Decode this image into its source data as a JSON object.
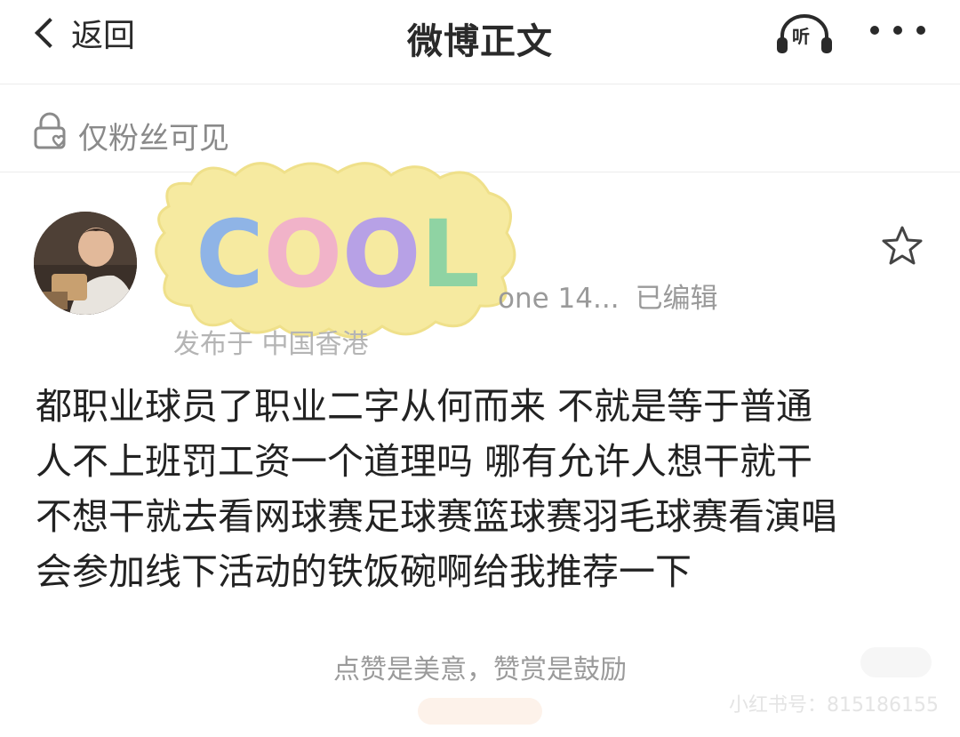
{
  "nav": {
    "back_label": "返回",
    "title": "微博正文",
    "listen_label": "听"
  },
  "visibility": {
    "label": "仅粉丝可见"
  },
  "post": {
    "sticker_text": "COOL",
    "device_text": "one 14...",
    "edited_label": "已编辑",
    "location": "发布于 中国香港",
    "body_lines": [
      "都职业球员了职业二字从何而来 不就是等于普通",
      "人不上班罚工资一个道理吗 哪有允许人想干就干",
      "不想干就去看网球赛足球赛篮球赛羽毛球赛看演唱",
      "会参加线下活动的铁饭碗啊给我推荐一下"
    ]
  },
  "footer": {
    "reward_text": "点赞是美意，赞赏是鼓励",
    "watermark": "小红书号：815186155"
  },
  "icons": {
    "back": "chevron-left-icon",
    "listen": "headphones-icon",
    "more": "more-dots-icon",
    "lock": "lock-heart-icon",
    "star": "star-outline-icon"
  }
}
